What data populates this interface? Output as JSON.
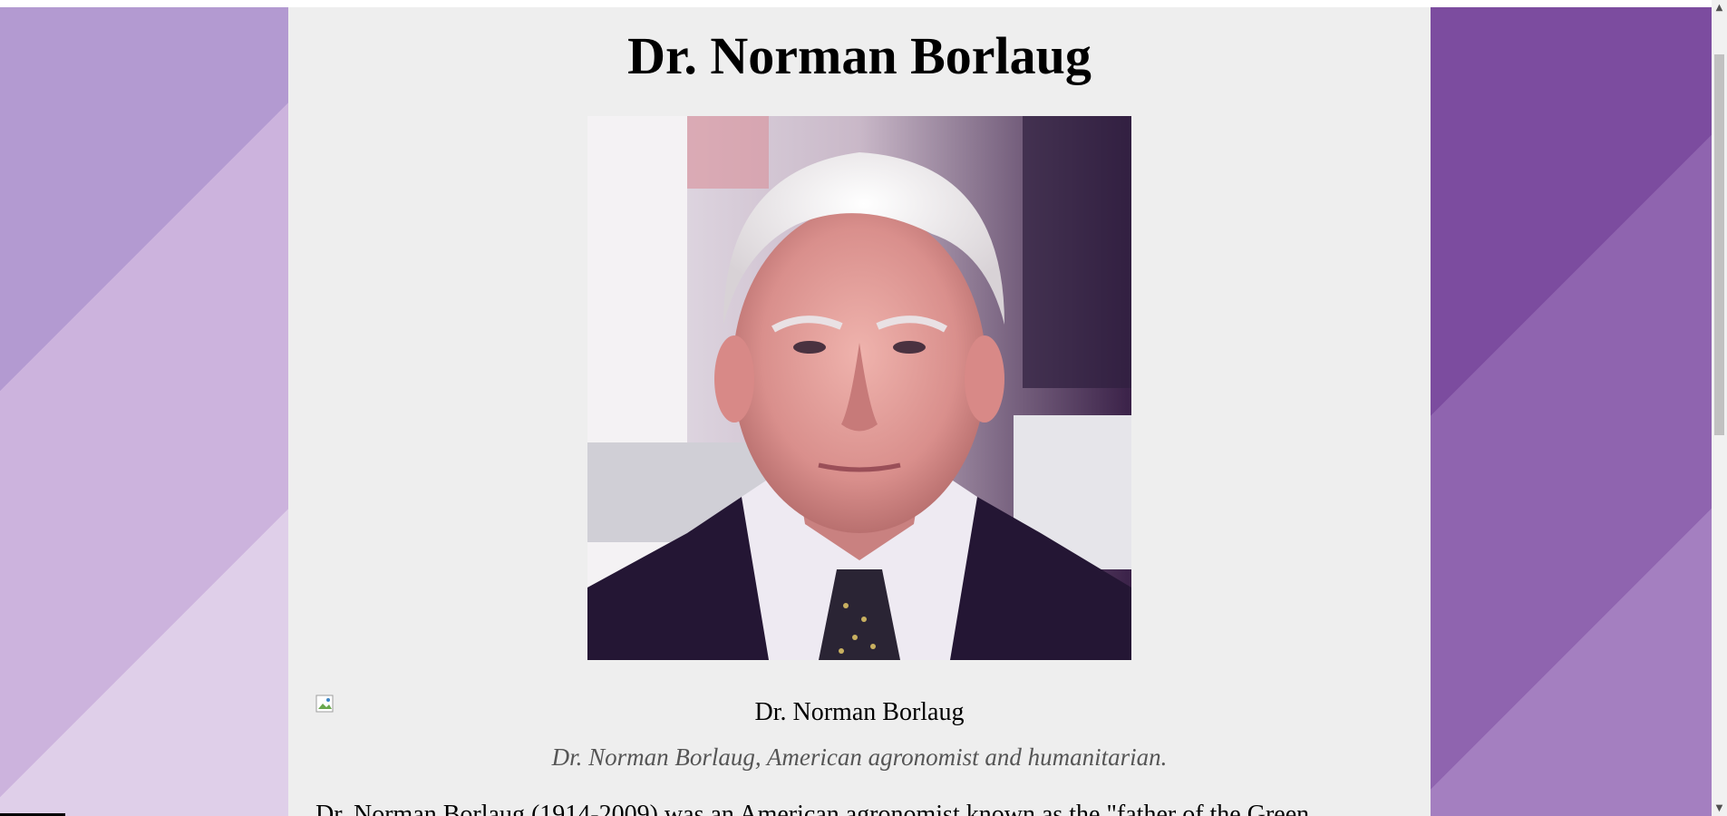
{
  "page": {
    "title": "Dr. Norman Borlaug"
  },
  "figure": {
    "image_alt": "Dr. Norman Borlaug",
    "caption_label": "Dr. Norman Borlaug",
    "subcaption": "Dr. Norman Borlaug, American agronomist and humanitarian."
  },
  "body": {
    "intro_partial": "Dr. Norman Borlaug (1914-2009) was an American agronomist known as the \"father of the Green"
  },
  "icons": {
    "broken_image": "broken-image-icon",
    "scroll_up": "chevron-up-icon",
    "scroll_down": "chevron-down-icon"
  },
  "colors": {
    "content_bg": "#eeeeee",
    "subcaption": "#555555",
    "purple_dark": "#7c4c9f",
    "purple_light": "#dfcfe9"
  }
}
